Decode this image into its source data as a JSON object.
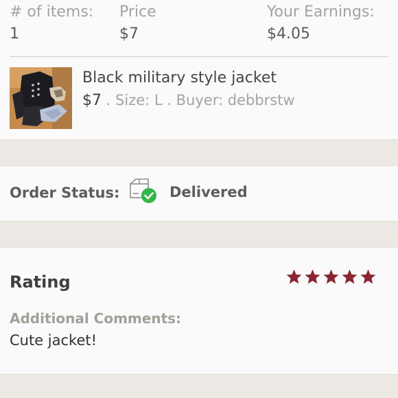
{
  "order_summary": {
    "items_label": "# of items:",
    "items_value": "1",
    "price_label": "Price",
    "price_value": "$7",
    "earnings_label": "Your Earnings:",
    "earnings_value": "$4.05"
  },
  "item": {
    "title": "Black military style jacket",
    "price": "$7",
    "sep1": " . ",
    "size": "Size: L",
    "sep2": " . ",
    "buyer": "Buyer: debbrstw"
  },
  "order_status": {
    "label": "Order Status:",
    "icon": "package-delivered-icon",
    "value": "Delivered"
  },
  "rating": {
    "title": "Rating",
    "stars": 5,
    "max_stars": 5,
    "star_color": "#8a2631",
    "comments_label": "Additional Comments:",
    "comment": "Cute jacket!"
  },
  "colors": {
    "background": "#ece9e4",
    "card": "#fbfafb",
    "delivered_badge": "#34b649"
  }
}
